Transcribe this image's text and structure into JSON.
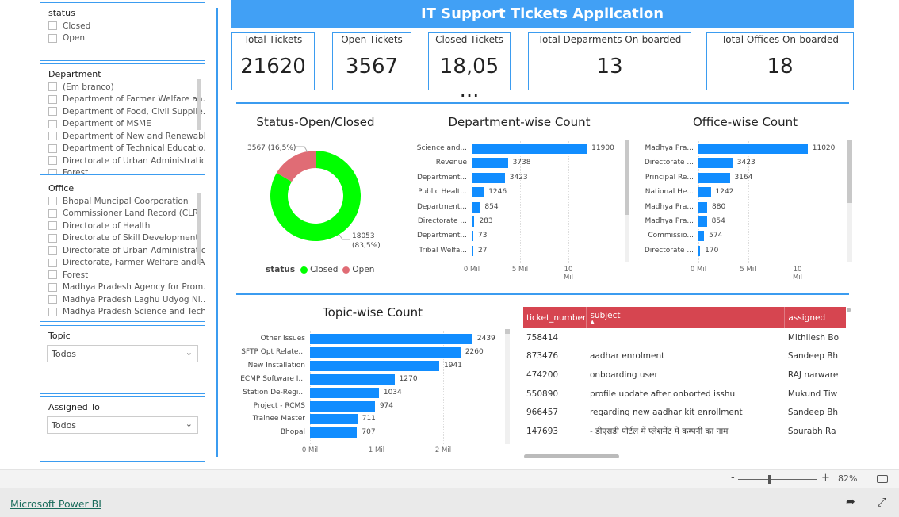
{
  "filters": {
    "status": {
      "title": "status",
      "items": [
        "Closed",
        "Open"
      ]
    },
    "department": {
      "title": "Department",
      "items": [
        "(Em branco)",
        "Department of Farmer Welfare an...",
        "Department of Food, Civil Supplie...",
        "Department of MSME",
        "Department of New and Renewabl...",
        "Department of Technical Educatio...",
        "Directorate of Urban Administratio...",
        "Forest"
      ]
    },
    "office": {
      "title": "Office",
      "items": [
        "Bhopal Muncipal Coorporation",
        "Commissioner Land Record (CLR) ...",
        "Directorate of Health",
        "Directorate of Skill Development",
        "Directorate of Urban Administratio...",
        "Directorate, Farmer Welfare and A...",
        "Forest",
        "Madhya Pradesh Agency for Prom...",
        "Madhya Pradesh Laghu Udyog Ni...",
        "Madhya Pradesh Science and Tech..."
      ]
    },
    "topic": {
      "title": "Topic",
      "value": "Todos"
    },
    "assigned": {
      "title": "Assigned To",
      "value": "Todos"
    }
  },
  "header": {
    "title": "IT Support Tickets Application"
  },
  "kpis": [
    {
      "label": "Total Tickets",
      "value": "21620"
    },
    {
      "label": "Open Tickets",
      "value": "3567"
    },
    {
      "label": "Closed Tickets",
      "value": "18,05 ..."
    },
    {
      "label": "Total Deparments On-boarded",
      "value": "13"
    },
    {
      "label": "Total Offices On-boarded",
      "value": "18"
    }
  ],
  "chart_data": [
    {
      "type": "pie",
      "title": "Status-Open/Closed",
      "legend_title": "status",
      "legend_position": "bottom",
      "slices": [
        {
          "name": "Closed",
          "value": 18053,
          "label": "18053",
          "pct": "(83,5%)",
          "color": "#00ff00"
        },
        {
          "name": "Open",
          "value": 3567,
          "label": "3567 (16,5%)",
          "color": "#e06c75"
        }
      ]
    },
    {
      "type": "bar",
      "title": "Department-wise Count",
      "categories": [
        "Science and...",
        "Revenue",
        "Department...",
        "Public Healt...",
        "Department...",
        "Directorate ...",
        "Department...",
        "Tribal Welfa..."
      ],
      "values": [
        11900,
        3738,
        3423,
        1246,
        854,
        283,
        73,
        27
      ],
      "xticks": [
        "0 Mil",
        "5 Mil",
        "10 Mil"
      ],
      "xtick_values": [
        0,
        5000,
        10000
      ],
      "color": "#118dff"
    },
    {
      "type": "bar",
      "title": "Office-wise Count",
      "categories": [
        "Madhya Pra...",
        "Directorate ...",
        "Principal Re...",
        "National He...",
        "Madhya Pra...",
        "Madhya Pra...",
        "Commissio...",
        "Directorate ..."
      ],
      "values": [
        11020,
        3423,
        3164,
        1242,
        880,
        854,
        574,
        170
      ],
      "xticks": [
        "0 Mil",
        "5 Mil",
        "10 Mil"
      ],
      "xtick_values": [
        0,
        5000,
        10000
      ],
      "color": "#118dff"
    },
    {
      "type": "bar",
      "title": "Topic-wise Count",
      "categories": [
        "Other Issues",
        "SFTP Opt Relate...",
        "New Installation",
        "ECMP Software I...",
        "Station De-Regi...",
        "Project - RCMS",
        "Trainee Master",
        "Bhopal"
      ],
      "values": [
        2439,
        2260,
        1941,
        1270,
        1034,
        974,
        711,
        707
      ],
      "xticks": [
        "0 Mil",
        "1 Mil",
        "2 Mil"
      ],
      "xtick_values": [
        0,
        1000,
        2000
      ],
      "color": "#118dff"
    }
  ],
  "table": {
    "columns": [
      "ticket_number",
      "subject",
      "assigned"
    ],
    "rows": [
      [
        "758414",
        "",
        "Mithilesh Bo"
      ],
      [
        "873476",
        "aadhar enrolment",
        "Sandeep Bh"
      ],
      [
        "474200",
        "onboarding user",
        "RAJ narware"
      ],
      [
        "550890",
        "profile update after onborted isshu",
        "Mukund Tiw"
      ],
      [
        "966457",
        "regarding new aadhar kit enrollment",
        "Sandeep Bh"
      ],
      [
        "147693",
        "- डीएसडी पोर्टल में प्लेशमेंट में कम्पनी का नाम",
        "Sourabh Ra"
      ]
    ]
  },
  "footer": {
    "zoom": "82%",
    "minus": "-",
    "plus": "+",
    "brand": "Microsoft Power BI"
  }
}
